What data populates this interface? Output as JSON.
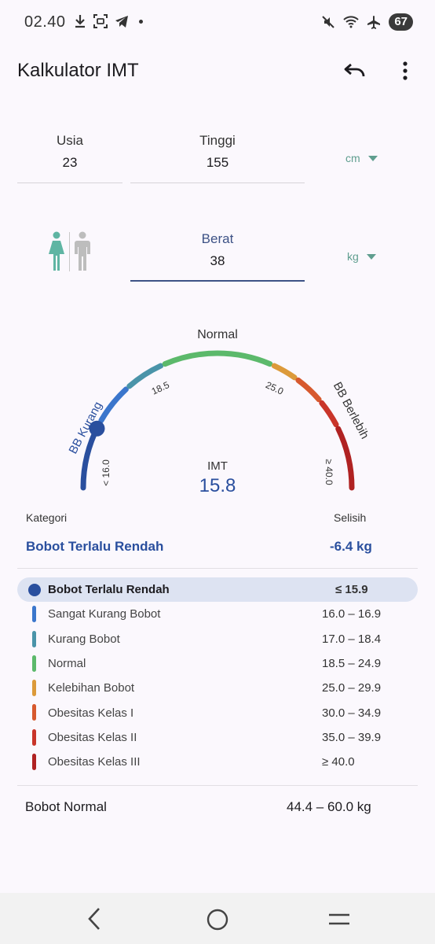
{
  "status": {
    "time": "02.40",
    "battery": "67"
  },
  "appbar": {
    "title": "Kalkulator IMT"
  },
  "fields": {
    "age": {
      "label": "Usia",
      "value": "23"
    },
    "height": {
      "label": "Tinggi",
      "value": "155",
      "unit": "cm"
    },
    "weight": {
      "label": "Berat",
      "value": "38",
      "unit": "kg"
    }
  },
  "gauge": {
    "labels": {
      "normal": "Normal",
      "underweight": "BB Kurang",
      "overweight": "BB Berlebih"
    },
    "ticks": {
      "low": "< 16.0",
      "t185": "18.5",
      "t25": "25.0",
      "high": "≥ 40.0"
    },
    "pointer_bmi": 15.8
  },
  "result": {
    "imt_label": "IMT",
    "imt_value": "15.8",
    "category_label": "Kategori",
    "diff_label": "Selisih",
    "category_value": "Bobot Terlalu Rendah",
    "diff_value": "-6.4 kg"
  },
  "categories": [
    {
      "name": "Bobot Terlalu Rendah",
      "range": "≤ 15.9",
      "color": "#2a4f9e",
      "selected": true
    },
    {
      "name": "Sangat Kurang Bobot",
      "range": "16.0 – 16.9",
      "color": "#3b76cc"
    },
    {
      "name": "Kurang Bobot",
      "range": "17.0 – 18.4",
      "color": "#4a94a9"
    },
    {
      "name": "Normal",
      "range": "18.5 – 24.9",
      "color": "#5cb96b"
    },
    {
      "name": "Kelebihan Bobot",
      "range": "25.0 – 29.9",
      "color": "#dc9a3a"
    },
    {
      "name": "Obesitas Kelas I",
      "range": "30.0 – 34.9",
      "color": "#d7592e"
    },
    {
      "name": "Obesitas Kelas II",
      "range": "35.0 – 39.9",
      "color": "#c9352a"
    },
    {
      "name": "Obesitas Kelas III",
      "range": "≥ 40.0",
      "color": "#b02222"
    }
  ],
  "normal_weight": {
    "label": "Bobot Normal",
    "value": "44.4 – 60.0 kg"
  },
  "colors": {
    "accent": "#2a4f9e",
    "unit": "#5f9e8f",
    "female_icon": "#5fb5a3",
    "male_icon": "#bdbdbd"
  }
}
